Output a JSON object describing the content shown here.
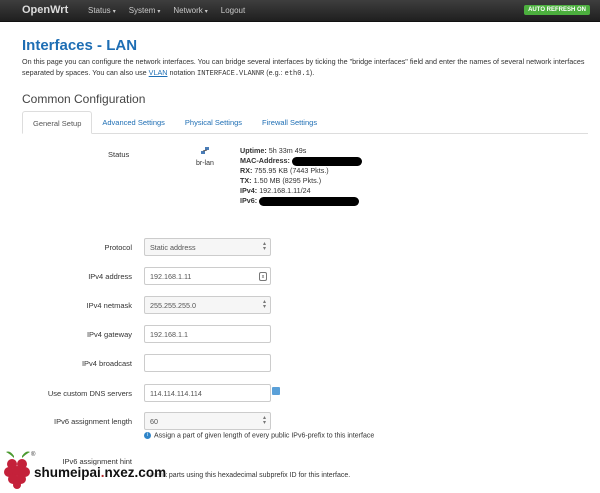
{
  "navbar": {
    "brand": "OpenWrt",
    "menu": [
      {
        "label": "Status",
        "caret": "▾"
      },
      {
        "label": "System",
        "caret": "▾"
      },
      {
        "label": "Network",
        "caret": "▾"
      },
      {
        "label": "Logout",
        "caret": ""
      }
    ],
    "refresh_badge": "AUTO REFRESH ON"
  },
  "page": {
    "title": "Interfaces - LAN",
    "desc_1": "On this page you can configure the network interfaces. You can bridge several interfaces by ticking the \"bridge interfaces\" field and enter the names of several network interfaces separated by spaces. You can also use ",
    "desc_link": "VLAN",
    "desc_2": " notation ",
    "desc_mono_1": "INTERFACE.VLANNR",
    "desc_3": " (e.g.: ",
    "desc_mono_2": "eth0.1",
    "desc_4": ")."
  },
  "section_title": "Common Configuration",
  "tabs": [
    {
      "label": "General Setup",
      "active": true
    },
    {
      "label": "Advanced Settings",
      "active": false
    },
    {
      "label": "Physical Settings",
      "active": false
    },
    {
      "label": "Firewall Settings",
      "active": false
    }
  ],
  "status": {
    "label": "Status",
    "interface": "br-lan",
    "uptime_key": "Uptime:",
    "uptime_val": "5h 33m 49s",
    "mac_key": "MAC-Address:",
    "rx_key": "RX:",
    "rx_val": "755.95 KB (7443 Pkts.)",
    "tx_key": "TX:",
    "tx_val": "1.50 MB (8295 Pkts.)",
    "ipv4_key": "IPv4:",
    "ipv4_val": "192.168.1.11/24",
    "ipv6_key": "IPv6:"
  },
  "form": {
    "protocol": {
      "label": "Protocol",
      "value": "Static address"
    },
    "ipv4_address": {
      "label": "IPv4 address",
      "value": "192.168.1.11"
    },
    "ipv4_netmask": {
      "label": "IPv4 netmask",
      "value": "255.255.255.0"
    },
    "ipv4_gateway": {
      "label": "IPv4 gateway",
      "value": "192.168.1.1"
    },
    "ipv4_broadcast": {
      "label": "IPv4 broadcast",
      "value": ""
    },
    "dns": {
      "label": "Use custom DNS servers",
      "value": "114.114.114.114"
    },
    "ipv6_len": {
      "label": "IPv6 assignment length",
      "value": "60",
      "hint": "Assign a part of given length of every public IPv6-prefix to this interface"
    },
    "ipv6_hint": {
      "label": "IPv6 assignment hint",
      "hint": "n prefix parts using this hexadecimal subprefix ID for this interface."
    }
  },
  "watermark": {
    "text_main": "shumeipai",
    "dot": ".",
    "text_tail": "nxez.com",
    "reg": "®"
  },
  "colors": {
    "accent": "#1e6eb4",
    "badge": "#4caf3e",
    "navbar": "#2a2a2a"
  }
}
